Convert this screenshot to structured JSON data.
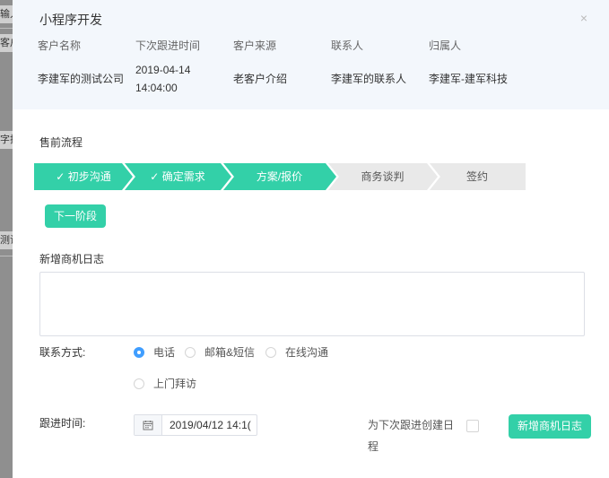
{
  "backdrop": {
    "fragments": [
      "输入",
      "客户",
      "字搜",
      "测试"
    ]
  },
  "dialog": {
    "title": "小程序开发",
    "close_symbol": "×"
  },
  "summary": {
    "headers": [
      "客户名称",
      "下次跟进时间",
      "客户来源",
      "联系人",
      "归属人"
    ],
    "values": {
      "customer_name": "李建军的测试公司",
      "next_followup_date": "2019-04-14",
      "next_followup_time": "14:04:00",
      "source": "老客户介绍",
      "contact": "李建军的联系人",
      "owner": "李建军-建军科技"
    }
  },
  "presale": {
    "label": "售前流程",
    "steps": [
      {
        "label": "初步沟通",
        "status": "done"
      },
      {
        "label": "确定需求",
        "status": "done"
      },
      {
        "label": "方案/报价",
        "status": "current"
      },
      {
        "label": "商务谈判",
        "status": "pending"
      },
      {
        "label": "签约",
        "status": "pending"
      }
    ],
    "next_button": "下一阶段"
  },
  "log": {
    "label": "新增商机日志",
    "content": ""
  },
  "contact_method": {
    "label": "联系方式:",
    "options": [
      {
        "label": "电话",
        "selected": true
      },
      {
        "label": "邮箱&短信",
        "selected": false
      },
      {
        "label": "在线沟通",
        "selected": false
      },
      {
        "label": "上门拜访",
        "selected": false
      }
    ]
  },
  "followup": {
    "label": "跟进时间:",
    "value": "2019/04/12 14:1("
  },
  "create_schedule": {
    "label": "为下次跟进创建日程",
    "checked": false
  },
  "submit_button": "新增商机日志",
  "colors": {
    "accent": "#33d0a8",
    "pending_step": "#e9e9e9",
    "header_bg": "#f3f7fc",
    "radio_selected": "#409eff"
  }
}
